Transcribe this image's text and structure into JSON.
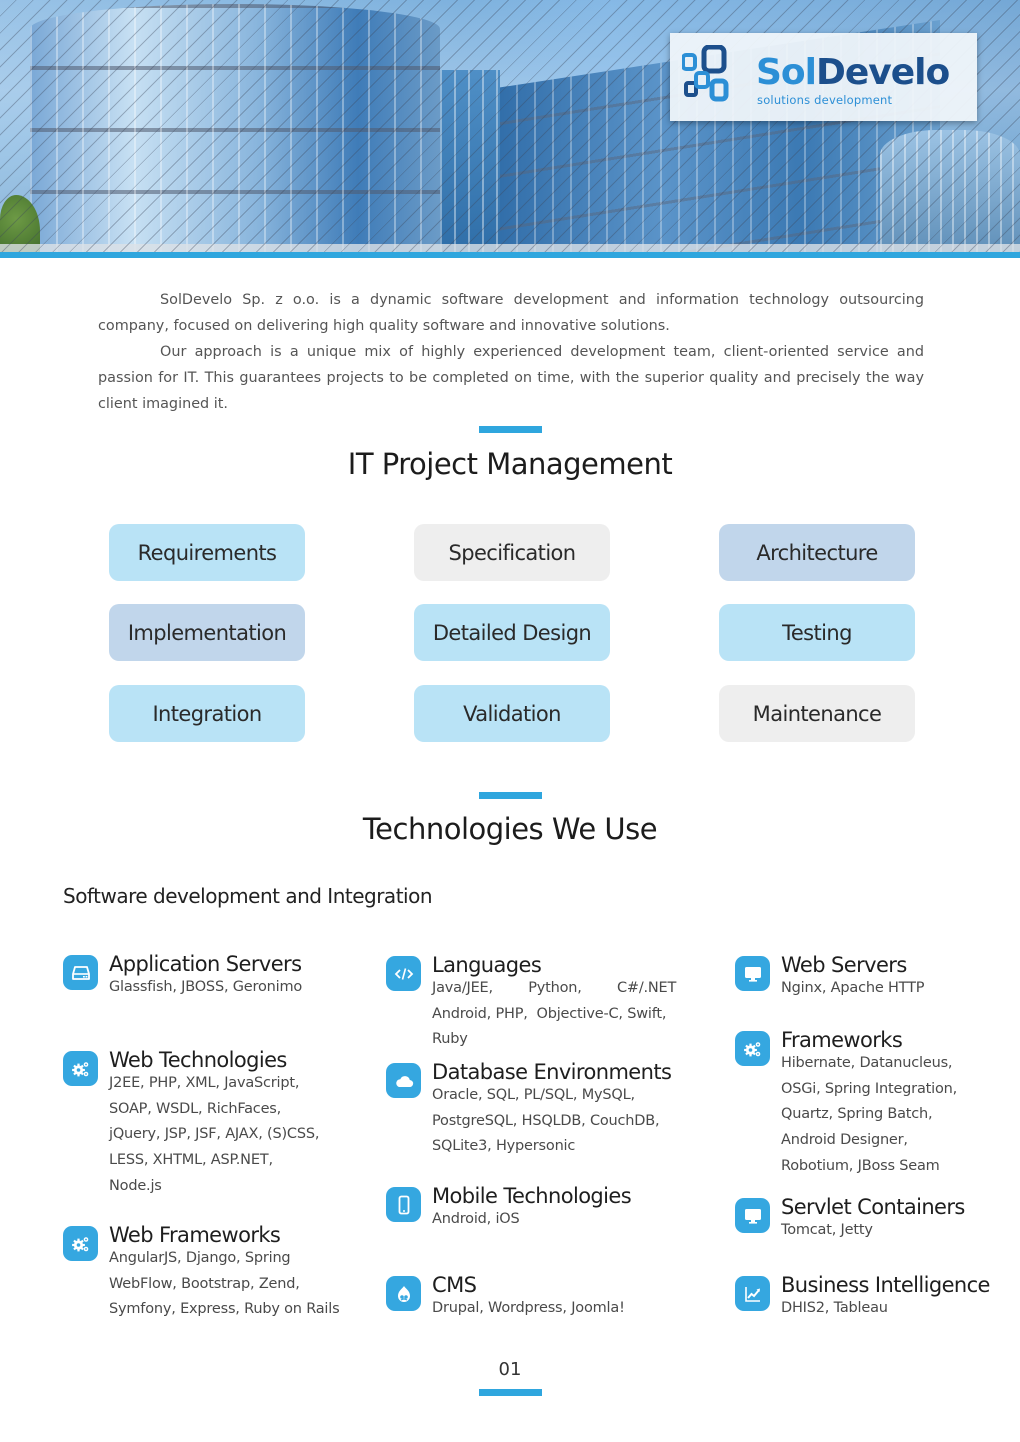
{
  "brand": {
    "name_part1": "Sol",
    "name_part2": "Develo",
    "tagline": "solutions development",
    "accent_color": "#2fa6de",
    "dark_color": "#1c4f8c"
  },
  "hero": {
    "image_description": "glass office building photo"
  },
  "intro": {
    "paragraph1": "SolDevelo Sp. z o.o. is a dynamic software development and information technology outsourcing company, focused on delivering high quality software and innovative solutions.",
    "paragraph2": "Our approach is a unique mix of highly experienced development team, client-oriented service and passion for IT. This guarantees projects to be completed on time, with the superior quality and precisely the way client imagined it."
  },
  "project_management": {
    "title": "IT Project Management",
    "phases": [
      {
        "label": "Requirements",
        "style": "light"
      },
      {
        "label": "Specification",
        "style": "gray"
      },
      {
        "label": "Architecture",
        "style": "steel"
      },
      {
        "label": "Implementation",
        "style": "steel"
      },
      {
        "label": "Detailed Design",
        "style": "light"
      },
      {
        "label": "Testing",
        "style": "light"
      },
      {
        "label": "Integration",
        "style": "light"
      },
      {
        "label": "Validation",
        "style": "light"
      },
      {
        "label": "Maintenance",
        "style": "gray"
      }
    ]
  },
  "technologies": {
    "title": "Technologies We Use",
    "subtitle": "Software development and Integration",
    "items": [
      {
        "title": "Application Servers",
        "icon": "server-icon",
        "lines": [
          "Glassfish, JBOSS, Geronimo"
        ]
      },
      {
        "title": "Web Technologies",
        "icon": "gears-icon",
        "lines": [
          "J2EE, PHP, XML, JavaScript,",
          "SOAP, WSDL, RichFaces,",
          "jQuery, JSP, JSF, AJAX, (S)CSS,",
          "LESS, XHTML, ASP.NET,",
          "Node.js"
        ]
      },
      {
        "title": "Web Frameworks",
        "icon": "gears-icon",
        "lines": [
          "AngularJS, Django, Spring",
          "WebFlow, Bootstrap, Zend,",
          "Symfony, Express, Ruby on Rails"
        ]
      },
      {
        "title": "Languages",
        "icon": "code-icon",
        "lines": [
          "Java/JEE,        Python,        C#/.NET",
          "Android, PHP,  Objective-C, Swift,",
          "Ruby"
        ]
      },
      {
        "title": "Database Environments",
        "icon": "cloud-icon",
        "lines": [
          "Oracle, SQL, PL/SQL, MySQL,",
          "PostgreSQL, HSQLDB, CouchDB,",
          "SQLite3, Hypersonic"
        ]
      },
      {
        "title": "Mobile Technologies",
        "icon": "mobile-icon",
        "lines": [
          "Android, iOS"
        ]
      },
      {
        "title": "CMS",
        "icon": "drupal-icon",
        "lines": [
          "Drupal, Wordpress, Joomla!"
        ]
      },
      {
        "title": "Web Servers",
        "icon": "monitor-icon",
        "lines": [
          "Nginx, Apache HTTP"
        ]
      },
      {
        "title": "Frameworks",
        "icon": "gears-icon",
        "lines": [
          "Hibernate, Datanucleus,",
          "OSGi, Spring Integration,",
          "Quartz, Spring Batch,",
          "Android Designer,",
          "Robotium, JBoss Seam"
        ]
      },
      {
        "title": "Servlet Containers",
        "icon": "monitor-icon",
        "lines": [
          "Tomcat, Jetty"
        ]
      },
      {
        "title": "Business Intelligence",
        "icon": "chart-icon",
        "lines": [
          "DHIS2, Tableau"
        ]
      }
    ]
  },
  "footer": {
    "page_number": "01"
  }
}
